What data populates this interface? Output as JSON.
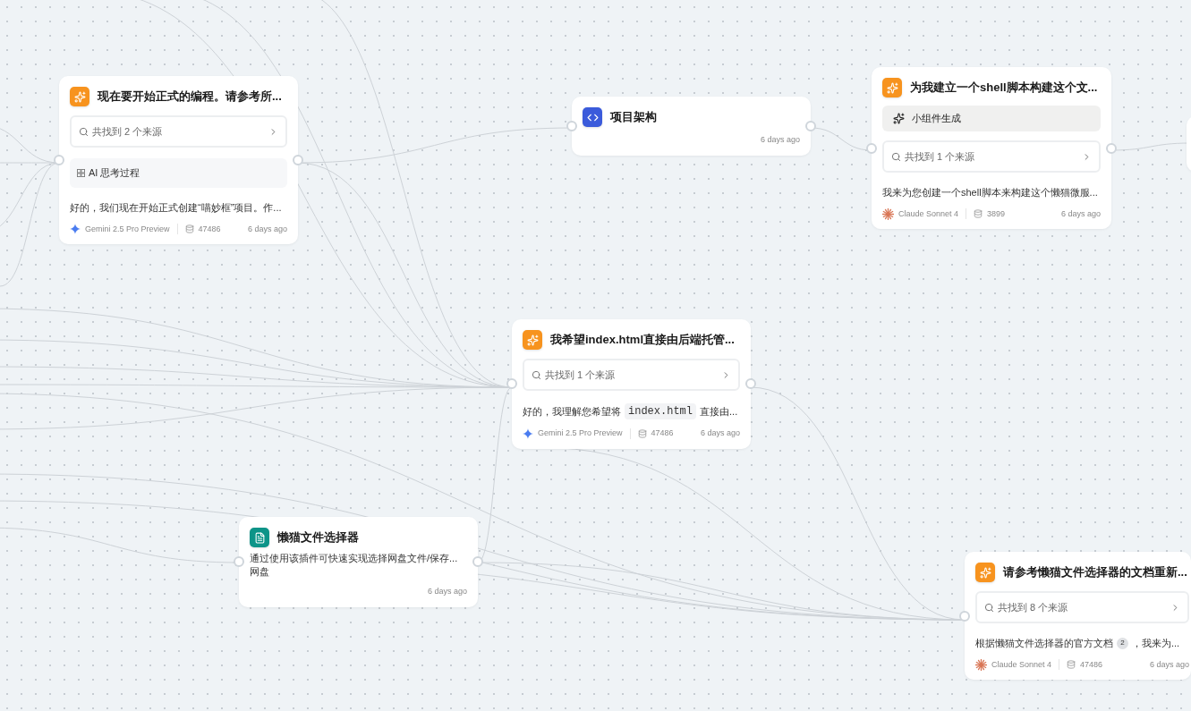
{
  "nodes": [
    {
      "kind": "chat",
      "title": "现在要开始正式的编程。请参考所...",
      "sources": "共找到 2 个来源",
      "thinking": "AI 思考过程",
      "answer": [
        {
          "kind": "text",
          "text": "好的，我们现在开始正式创建“喵妙框”项目。作..."
        }
      ],
      "model": {
        "kind": "gemini",
        "name": "Gemini 2.5 Pro Preview"
      },
      "tokens": "47486",
      "time": "6 days ago"
    },
    {
      "kind": "code",
      "title": "项目架构",
      "time": "6 days ago"
    },
    {
      "kind": "chat",
      "title": "为我建立一个shell脚本构建这个文...",
      "widget": "小组件生成",
      "sources": "共找到 1 个来源",
      "answer": [
        {
          "kind": "text",
          "text": "我来为您创建一个shell脚本来构建这个懒猫微服..."
        }
      ],
      "model": {
        "kind": "claude",
        "name": "Claude Sonnet 4"
      },
      "tokens": "3899",
      "time": "6 days ago"
    },
    {
      "kind": "chat",
      "title": "我希望index.html直接由后端托管...",
      "sources": "共找到 1 个来源",
      "answer": [
        {
          "kind": "text",
          "text": "好的，我理解您希望将"
        },
        {
          "kind": "code",
          "text": "index.html"
        },
        {
          "kind": "text",
          "text": "直接由..."
        }
      ],
      "model": {
        "kind": "gemini",
        "name": "Gemini 2.5 Pro Preview"
      },
      "tokens": "47486",
      "time": "6 days ago"
    },
    {
      "kind": "file",
      "title": "懒猫文件选择器",
      "description": [
        "通过使用该插件可快速实现选择网盘文件/保存...",
        "网盘"
      ],
      "time": "6 days ago"
    },
    {
      "kind": "chat",
      "title": "请参考懒猫文件选择器的文档重新...",
      "sources": "共找到 8 个来源",
      "answer": [
        {
          "kind": "text",
          "text": "根据懒猫文件选择器的官方文档"
        },
        {
          "kind": "cite",
          "text": "2"
        },
        {
          "kind": "text",
          "text": "，我来为..."
        }
      ],
      "model": {
        "kind": "claude",
        "name": "Claude Sonnet 4"
      },
      "tokens": "47486",
      "time": "6 days ago"
    },
    {
      "kind": "stub"
    }
  ]
}
